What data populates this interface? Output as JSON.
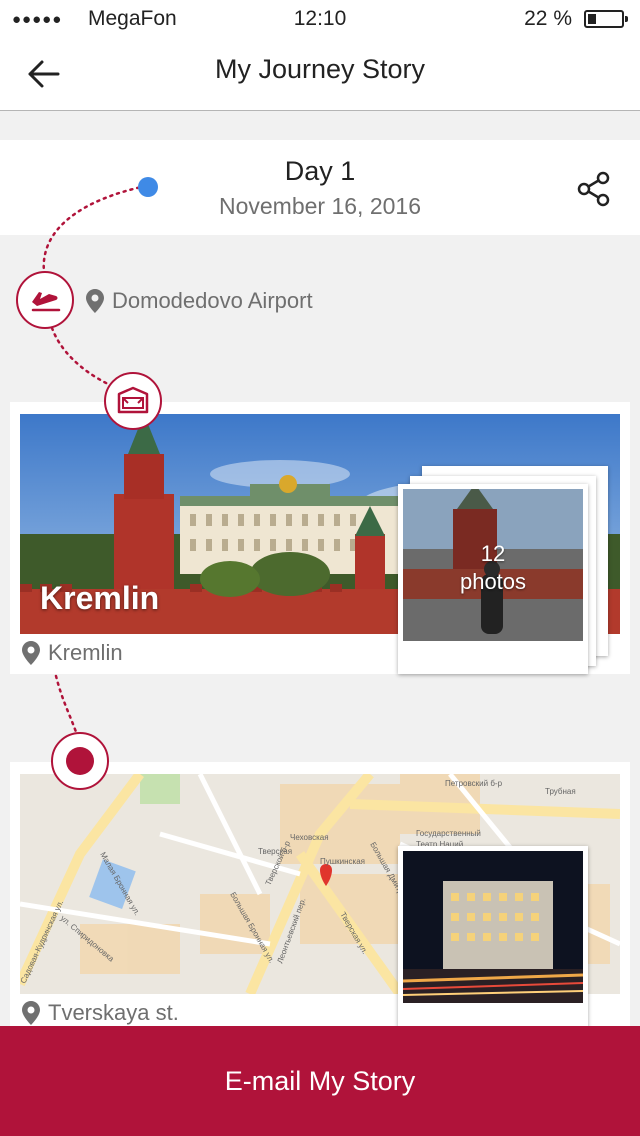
{
  "status": {
    "carrier": "MegaFon",
    "time": "12:10",
    "battery": "22 %",
    "signal_dots": "●●●●●",
    "battery_level": 0.22
  },
  "nav": {
    "title": "My Journey Story",
    "back_icon": "back-arrow-icon"
  },
  "day": {
    "label": "Day 1",
    "date": "November 16, 2016",
    "share_icon": "share-icon"
  },
  "timeline": [
    {
      "type": "flight",
      "icon": "airplane-icon",
      "location": "Domodedovo Airport"
    },
    {
      "type": "sightseeing",
      "icon": "landmark-icon",
      "title": "Kremlin",
      "location": "Kremlin",
      "photo_count": "12",
      "photo_word": "photos"
    },
    {
      "type": "place",
      "icon": "location-dot-icon",
      "location": "Tverskaya st.",
      "map_labels": [
        "Петровский б-р",
        "Трубная",
        "Чеховская",
        "Государственный",
        "Театр Наций",
        "Тверская",
        "Пушкинская",
        "Малая Бронная ул.",
        "Большая Бронная ул.",
        "Тверской б-р",
        "ул. Спиридоновка",
        "Леонтьевский пер.",
        "Тверская ул.",
        "Большая Дмитровка",
        "Садовая-Кудринская ул."
      ]
    }
  ],
  "action": {
    "email_label": "E-mail My Story"
  },
  "colors": {
    "accent": "#b0133a",
    "start_dot": "#3f8ae6",
    "text_secondary": "#6f6f6f"
  }
}
